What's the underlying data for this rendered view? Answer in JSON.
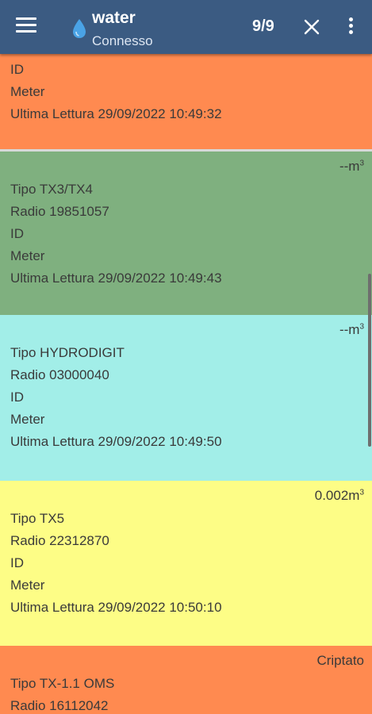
{
  "appbar": {
    "title": "water",
    "subtitle": "Connesso",
    "counter": "9/9"
  },
  "cards": [
    {
      "color": "#ff8a50",
      "lines": [
        "ID",
        "Meter",
        "Ultima Lettura 29/09/2022 10:49:32"
      ]
    },
    {
      "color": "#7fb07f",
      "reading": "--m",
      "unit_exp": "3",
      "lines": [
        "Tipo TX3/TX4",
        "Radio 19851057",
        "ID",
        "Meter",
        "Ultima Lettura 29/09/2022 10:49:43"
      ]
    },
    {
      "color": "#a2eee8",
      "reading": "--m",
      "unit_exp": "3",
      "lines": [
        "Tipo HYDRODIGIT",
        "Radio 03000040",
        "ID",
        "Meter",
        "Ultima Lettura 29/09/2022 10:49:50"
      ]
    },
    {
      "color": "#fdfd86",
      "reading": "0.002m",
      "unit_exp": "3",
      "lines": [
        "Tipo TX5",
        "Radio 22312870",
        "ID",
        "Meter",
        "Ultima Lettura 29/09/2022 10:50:10"
      ]
    },
    {
      "color": "#ff8a50",
      "reading": "Criptato",
      "lines": [
        "Tipo TX-1.1 OMS",
        "Radio 16112042"
      ]
    }
  ]
}
